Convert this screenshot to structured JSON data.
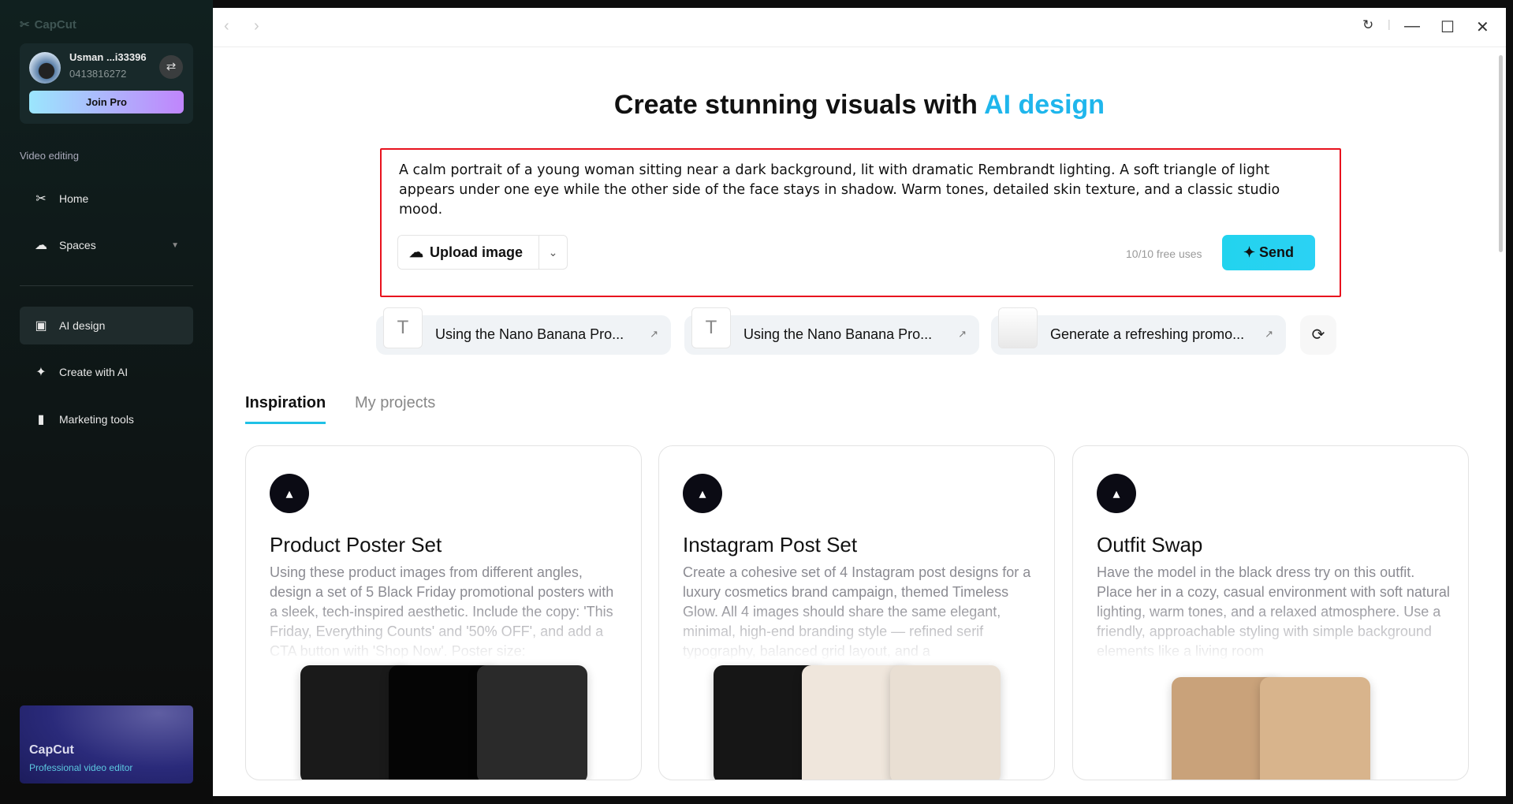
{
  "app": {
    "name": "CapCut"
  },
  "user": {
    "name": "Usman ...i33396",
    "phone": "0413816272",
    "join_label": "Join Pro"
  },
  "sidebar": {
    "section": "Video editing",
    "items": [
      {
        "label": "Home"
      },
      {
        "label": "Spaces"
      },
      {
        "label": "AI design"
      },
      {
        "label": "Create with AI"
      },
      {
        "label": "Marketing tools"
      }
    ],
    "promo": {
      "title": "CapCut",
      "subtitle": "Professional video editor"
    }
  },
  "main": {
    "title_prefix": "Create stunning visuals with ",
    "title_highlight": "AI design",
    "prompt_text": "A calm portrait of a young woman sitting near a dark background, lit with dramatic Rembrandt lighting. A soft triangle of light appears under one eye while the other side of the face stays in shadow. Warm tones, detailed skin texture, and a classic studio mood.",
    "upload_label": "Upload image",
    "uses": "10/10 free uses",
    "send_label": "Send",
    "suggestions": [
      {
        "label": "Using the Nano Banana Pro..."
      },
      {
        "label": "Using the Nano Banana Pro..."
      },
      {
        "label": "Generate a refreshing promo..."
      }
    ],
    "tabs": [
      {
        "label": "Inspiration"
      },
      {
        "label": "My projects"
      }
    ],
    "cards": [
      {
        "title": "Product Poster Set",
        "desc": "Using these product images from different angles, design a set of 5 Black Friday promotional posters with a sleek, tech-inspired aesthetic. Include the copy: 'This Friday, Everything Counts' and '50% OFF', and add a CTA button with 'Shop Now'. Poster size:"
      },
      {
        "title": "Instagram Post Set",
        "desc": "Create a cohesive set of 4 Instagram post designs for a luxury cosmetics brand campaign, themed Timeless Glow. All 4 images should share the same elegant, minimal, high-end branding style — refined serif typography, balanced grid layout, and a"
      },
      {
        "title": "Outfit Swap",
        "desc": "Have the model in the black dress try on this outfit. Place her in a cozy, casual environment with soft natural lighting, warm tones, and a relaxed atmosphere. Use a friendly, approachable styling with simple background elements like a living room"
      }
    ]
  },
  "colors": {
    "accent": "#1fb6ec",
    "highlight_border": "#e8121e"
  }
}
